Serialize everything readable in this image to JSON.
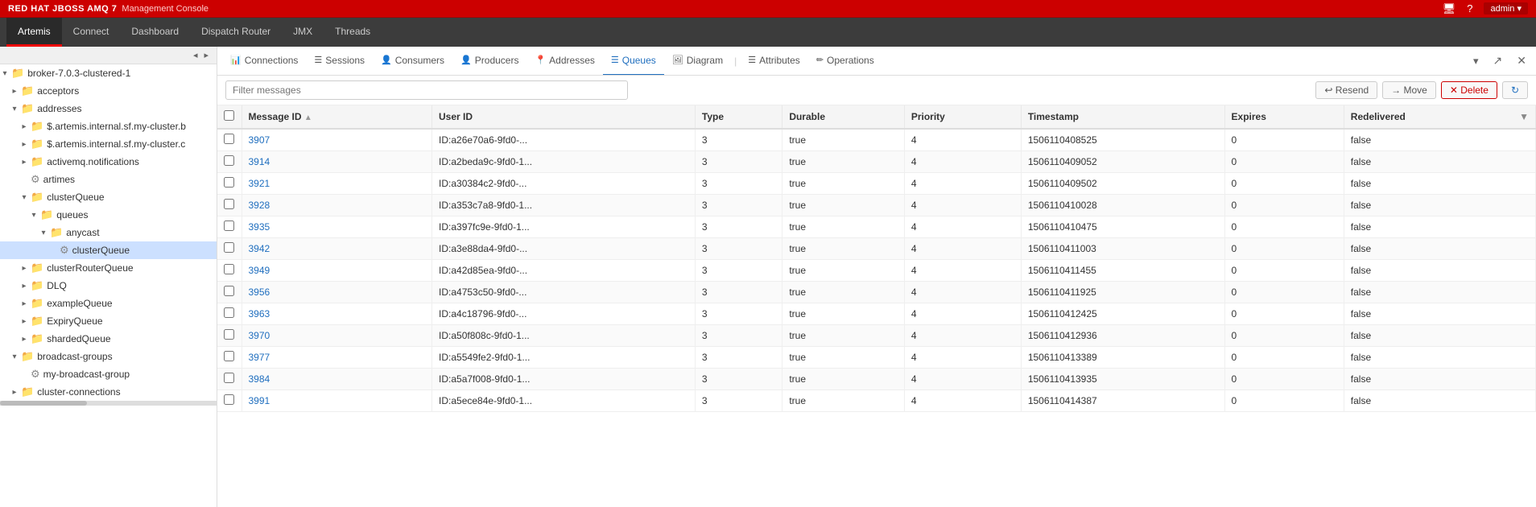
{
  "topbar": {
    "brand": "RED HAT JBOSS AMQ 7",
    "console": "Management Console",
    "admin": "admin ▾"
  },
  "nav": {
    "items": [
      {
        "id": "artemis",
        "label": "Artemis",
        "active": true
      },
      {
        "id": "connect",
        "label": "Connect",
        "active": false
      },
      {
        "id": "dashboard",
        "label": "Dashboard",
        "active": false
      },
      {
        "id": "dispatch-router",
        "label": "Dispatch Router",
        "active": false
      },
      {
        "id": "jmx",
        "label": "JMX",
        "active": false
      },
      {
        "id": "threads",
        "label": "Threads",
        "active": false
      }
    ]
  },
  "sidebar": {
    "items": [
      {
        "id": "broker",
        "label": "broker-7.0.3-clustered-1",
        "indent": 1,
        "type": "folder-open",
        "expanded": true
      },
      {
        "id": "acceptors",
        "label": "acceptors",
        "indent": 2,
        "type": "folder",
        "expanded": false
      },
      {
        "id": "addresses",
        "label": "addresses",
        "indent": 2,
        "type": "folder-open",
        "expanded": true
      },
      {
        "id": "artemis-internal-1",
        "label": "$.artemis.internal.sf.my-cluster.b",
        "indent": 3,
        "type": "folder",
        "expanded": false
      },
      {
        "id": "artemis-internal-2",
        "label": "$.artemis.internal.sf.my-cluster.c",
        "indent": 3,
        "type": "folder",
        "expanded": false
      },
      {
        "id": "activemq-notifications",
        "label": "activemq.notifications",
        "indent": 3,
        "type": "folder",
        "expanded": false
      },
      {
        "id": "artimes",
        "label": "artimes",
        "indent": 3,
        "type": "gear",
        "expanded": false
      },
      {
        "id": "clusterQueue",
        "label": "clusterQueue",
        "indent": 3,
        "type": "folder-open",
        "expanded": true
      },
      {
        "id": "queues",
        "label": "queues",
        "indent": 4,
        "type": "folder-open",
        "expanded": true
      },
      {
        "id": "anycast",
        "label": "anycast",
        "indent": 5,
        "type": "folder-open",
        "expanded": true
      },
      {
        "id": "clusterQueue-item",
        "label": "clusterQueue",
        "indent": 6,
        "type": "gear",
        "expanded": false,
        "selected": true
      },
      {
        "id": "clusterRouterQueue",
        "label": "clusterRouterQueue",
        "indent": 3,
        "type": "folder",
        "expanded": false
      },
      {
        "id": "DLQ",
        "label": "DLQ",
        "indent": 3,
        "type": "folder",
        "expanded": false
      },
      {
        "id": "exampleQueue",
        "label": "exampleQueue",
        "indent": 3,
        "type": "folder",
        "expanded": false
      },
      {
        "id": "ExpiryQueue",
        "label": "ExpiryQueue",
        "indent": 3,
        "type": "folder",
        "expanded": false
      },
      {
        "id": "shardedQueue",
        "label": "shardedQueue",
        "indent": 3,
        "type": "folder",
        "expanded": false
      },
      {
        "id": "broadcast-groups",
        "label": "broadcast-groups",
        "indent": 2,
        "type": "folder-open",
        "expanded": true
      },
      {
        "id": "my-broadcast-group",
        "label": "my-broadcast-group",
        "indent": 3,
        "type": "gear",
        "expanded": false
      },
      {
        "id": "cluster-connections",
        "label": "cluster-connections",
        "indent": 2,
        "type": "folder",
        "expanded": false
      }
    ]
  },
  "tabs": {
    "items": [
      {
        "id": "connections",
        "label": "Connections",
        "icon": "📊",
        "active": false
      },
      {
        "id": "sessions",
        "label": "Sessions",
        "icon": "☰",
        "active": false
      },
      {
        "id": "consumers",
        "label": "Consumers",
        "icon": "👤",
        "active": false
      },
      {
        "id": "producers",
        "label": "Producers",
        "icon": "👤",
        "active": false
      },
      {
        "id": "addresses",
        "label": "Addresses",
        "icon": "📍",
        "active": false
      },
      {
        "id": "queues",
        "label": "Queues",
        "icon": "☰",
        "active": false
      },
      {
        "id": "diagram",
        "label": "Diagram",
        "icon": "🖼",
        "active": false
      }
    ],
    "sep": "|",
    "right_items": [
      {
        "id": "attributes",
        "label": "Attributes",
        "icon": "☰",
        "active": false
      },
      {
        "id": "operations",
        "label": "Operations",
        "icon": "✏",
        "active": false
      }
    ],
    "dropdown_label": "▾",
    "refresh_label": "↻",
    "close_label": "✕"
  },
  "filter": {
    "placeholder": "Filter messages",
    "resend_label": "↩ Resend",
    "move_label": "→ Move",
    "delete_label": "✕ Delete",
    "refresh_label": "↻"
  },
  "table": {
    "columns": [
      {
        "id": "checkbox",
        "label": ""
      },
      {
        "id": "message-id",
        "label": "Message ID"
      },
      {
        "id": "user-id",
        "label": "User ID"
      },
      {
        "id": "type",
        "label": "Type"
      },
      {
        "id": "durable",
        "label": "Durable"
      },
      {
        "id": "priority",
        "label": "Priority"
      },
      {
        "id": "timestamp",
        "label": "Timestamp"
      },
      {
        "id": "expires",
        "label": "Expires"
      },
      {
        "id": "redelivered",
        "label": "Redelivered"
      }
    ],
    "rows": [
      {
        "msg_id": "3907",
        "user_id": "ID:a26e70a6-9fd0-...",
        "type": "3",
        "durable": "true",
        "priority": "4",
        "timestamp": "1506110408525",
        "expires": "0",
        "redelivered": "false"
      },
      {
        "msg_id": "3914",
        "user_id": "ID:a2beda9c-9fd0-1...",
        "type": "3",
        "durable": "true",
        "priority": "4",
        "timestamp": "1506110409052",
        "expires": "0",
        "redelivered": "false"
      },
      {
        "msg_id": "3921",
        "user_id": "ID:a30384c2-9fd0-...",
        "type": "3",
        "durable": "true",
        "priority": "4",
        "timestamp": "1506110409502",
        "expires": "0",
        "redelivered": "false"
      },
      {
        "msg_id": "3928",
        "user_id": "ID:a353c7a8-9fd0-1...",
        "type": "3",
        "durable": "true",
        "priority": "4",
        "timestamp": "1506110410028",
        "expires": "0",
        "redelivered": "false"
      },
      {
        "msg_id": "3935",
        "user_id": "ID:a397fc9e-9fd0-1...",
        "type": "3",
        "durable": "true",
        "priority": "4",
        "timestamp": "1506110410475",
        "expires": "0",
        "redelivered": "false"
      },
      {
        "msg_id": "3942",
        "user_id": "ID:a3e88da4-9fd0-...",
        "type": "3",
        "durable": "true",
        "priority": "4",
        "timestamp": "1506110411003",
        "expires": "0",
        "redelivered": "false"
      },
      {
        "msg_id": "3949",
        "user_id": "ID:a42d85ea-9fd0-...",
        "type": "3",
        "durable": "true",
        "priority": "4",
        "timestamp": "1506110411455",
        "expires": "0",
        "redelivered": "false"
      },
      {
        "msg_id": "3956",
        "user_id": "ID:a4753c50-9fd0-...",
        "type": "3",
        "durable": "true",
        "priority": "4",
        "timestamp": "1506110411925",
        "expires": "0",
        "redelivered": "false"
      },
      {
        "msg_id": "3963",
        "user_id": "ID:a4c18796-9fd0-...",
        "type": "3",
        "durable": "true",
        "priority": "4",
        "timestamp": "1506110412425",
        "expires": "0",
        "redelivered": "false"
      },
      {
        "msg_id": "3970",
        "user_id": "ID:a50f808c-9fd0-1...",
        "type": "3",
        "durable": "true",
        "priority": "4",
        "timestamp": "1506110412936",
        "expires": "0",
        "redelivered": "false"
      },
      {
        "msg_id": "3977",
        "user_id": "ID:a5549fe2-9fd0-1...",
        "type": "3",
        "durable": "true",
        "priority": "4",
        "timestamp": "1506110413389",
        "expires": "0",
        "redelivered": "false"
      },
      {
        "msg_id": "3984",
        "user_id": "ID:a5a7f008-9fd0-1...",
        "type": "3",
        "durable": "true",
        "priority": "4",
        "timestamp": "1506110413935",
        "expires": "0",
        "redelivered": "false"
      },
      {
        "msg_id": "3991",
        "user_id": "ID:a5ece84e-9fd0-1...",
        "type": "3",
        "durable": "true",
        "priority": "4",
        "timestamp": "1506110414387",
        "expires": "0",
        "redelivered": "false"
      }
    ]
  }
}
